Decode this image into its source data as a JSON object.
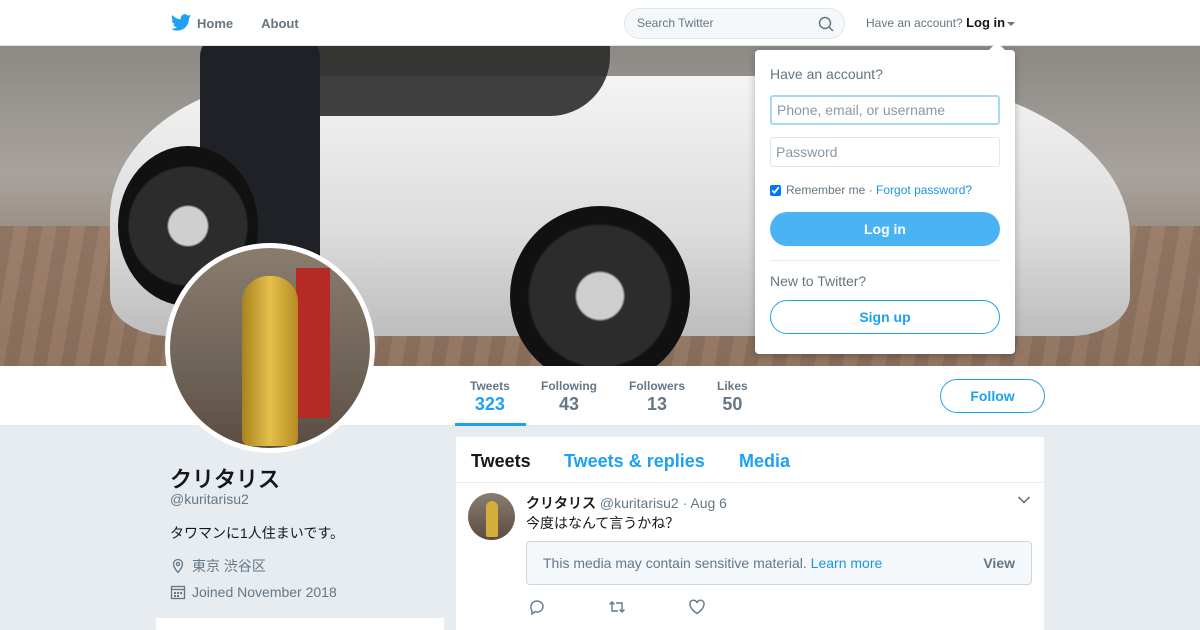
{
  "nav": {
    "home_label": "Home",
    "about_label": "About",
    "search_placeholder": "Search Twitter",
    "have_account_text": "Have an account?",
    "login_label": "Log in"
  },
  "profile": {
    "display_name": "クリタリス",
    "handle": "@kuritarisu2",
    "bio": "タワマンに1人住まいです。",
    "location": "東京 渋谷区",
    "joined": "Joined November 2018",
    "follow_label": "Follow"
  },
  "stats": [
    {
      "label": "Tweets",
      "value": "323"
    },
    {
      "label": "Following",
      "value": "43"
    },
    {
      "label": "Followers",
      "value": "13"
    },
    {
      "label": "Likes",
      "value": "50"
    }
  ],
  "timeline": {
    "tabs": [
      "Tweets",
      "Tweets & replies",
      "Media"
    ],
    "tweet": {
      "name": "クリタリス",
      "handle": "@kuritarisu2",
      "separator": "·",
      "date": "Aug 6",
      "text": "今度はなんて言うかね？",
      "sensitive_msg": "This media may contain sensitive material.",
      "learn_more": "Learn more",
      "view_label": "View"
    }
  },
  "login_dropdown": {
    "title": "Have an account?",
    "username_placeholder": "Phone, email, or username",
    "password_placeholder": "Password",
    "remember_label": "Remember me",
    "separator": "·",
    "forgot_label": "Forgot password?",
    "login_button": "Log in",
    "new_prompt": "New to Twitter?",
    "signup_button": "Sign up"
  },
  "colors": {
    "accent": "#1da1f2",
    "background": "#e6ecf0"
  },
  "icons": [
    "twitter-bird-icon",
    "home-icon",
    "search-icon",
    "caret-down-icon",
    "location-icon",
    "calendar-icon",
    "chevron-down-icon",
    "reply-icon",
    "retweet-icon",
    "like-icon"
  ]
}
